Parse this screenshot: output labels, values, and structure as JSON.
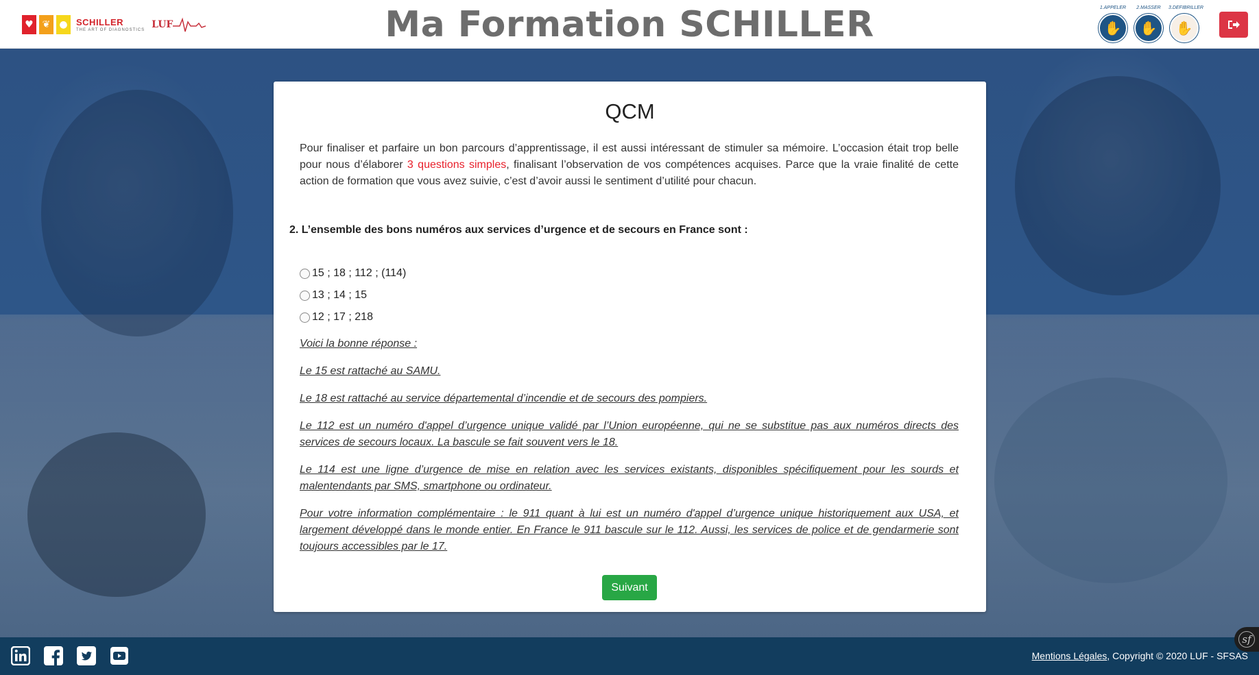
{
  "header": {
    "site_title": "Ma Formation SCHILLER",
    "logo_schiller": "SCHILLER",
    "logo_schiller_sub": "THE ART OF DIAGNOSTICS",
    "logo_luf": "LUF",
    "badges": [
      {
        "caption": "1.APPELER",
        "icon": "phone-hand-icon"
      },
      {
        "caption": "2.MASSER",
        "icon": "hand-icon"
      },
      {
        "caption": "3.DEFIBRILLER",
        "icon": "defibrillator-icon"
      }
    ],
    "logout_icon": "sign-out-icon"
  },
  "card": {
    "title": "QCM",
    "intro_part1": "Pour finaliser et parfaire un bon parcours d’apprentissage, il est aussi intéressant de stimuler sa mémoire. L’occasion était trop belle pour nous d’élaborer ",
    "intro_highlight": "3 questions simples",
    "intro_part2": ", finalisant l’observation de vos compétences acquises. Parce que la vraie finalité de cette action de formation que vous avez suivie, c’est d’avoir aussi le sentiment d’utilité pour chacun.",
    "question": "2. L’ensemble des bons numéros aux services d’urgence et de secours en France sont :",
    "options": [
      "15 ; 18 ; 112 ; (114)",
      "13 ; 14 ; 15",
      "12 ; 17 ; 218"
    ],
    "answer_heading": "Voici la bonne réponse :",
    "answer_lines": [
      "Le 15 est rattaché au SAMU.",
      "Le 18 est rattaché au service départemental d’incendie et de secours des pompiers.",
      "Le 112 est un numéro d'appel d’urgence unique validé par l’Union européenne, qui ne se substitue pas aux numéros directs des services de secours locaux. La bascule se fait souvent vers le 18.",
      "Le 114 est une ligne d’urgence de mise en relation avec les services existants, disponibles spécifiquement pour les sourds et malentendants par SMS, smartphone ou ordinateur.",
      "Pour votre information complémentaire : le 911 quant à lui est un numéro d'appel d’urgence unique historiquement aux USA, et largement développé dans le monde entier. En France le 911 bascule sur le 112. Aussi, les services de police et de gendarmerie sont toujours accessibles par le 17."
    ],
    "next_label": "Suivant"
  },
  "footer": {
    "socials": [
      "linkedin-icon",
      "facebook-icon",
      "twitter-icon",
      "youtube-icon"
    ],
    "legal_link": "Mentions Légales",
    "copyright": ", Copyright © 2020 LUF - SFSAS"
  },
  "colors": {
    "accent_red": "#dc3545",
    "highlight_red": "#e8202b",
    "button_green": "#28a745",
    "footer_blue": "#123d5e",
    "title_grey": "#6d6d6d"
  }
}
